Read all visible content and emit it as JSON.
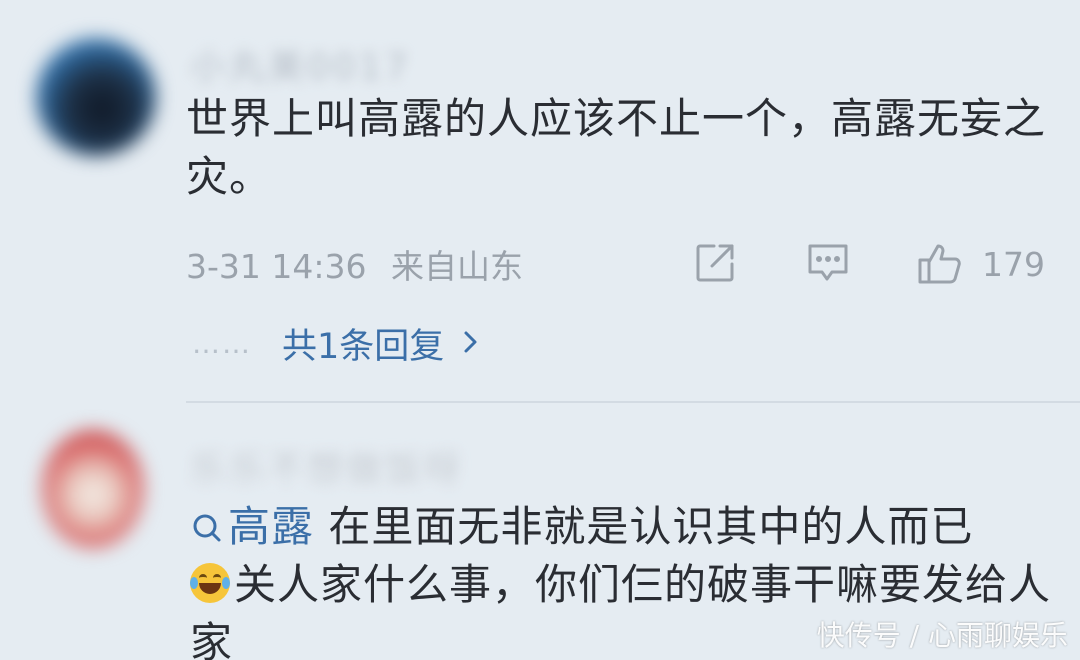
{
  "comments": [
    {
      "username": "小丸美0017",
      "text": "世界上叫高露的人应该不止一个，高露无妄之灾。",
      "date": "3-31 14:36",
      "source": "来自山东",
      "like_count": "179",
      "replies_label": "共1条回复",
      "dots": "……"
    },
    {
      "username": "乐乐不想做饭呀",
      "search_tag": "高露",
      "text_line1": "在里面无非就是认识其中的人而已",
      "text_line2": "关人家什么事，你们仨的破事干嘛要发给人家",
      "emoji": "laughing-crying-emoji"
    }
  ],
  "icons": [
    "share-icon",
    "comment-icon",
    "thumbs-up-icon",
    "chevron-right-icon",
    "search-icon"
  ],
  "colors": {
    "background": "#e5ecf2",
    "link": "#3b6fa8",
    "meta": "#9aa2ab",
    "text": "#2a2d33"
  },
  "watermark": "快传号 / 心雨聊娱乐"
}
